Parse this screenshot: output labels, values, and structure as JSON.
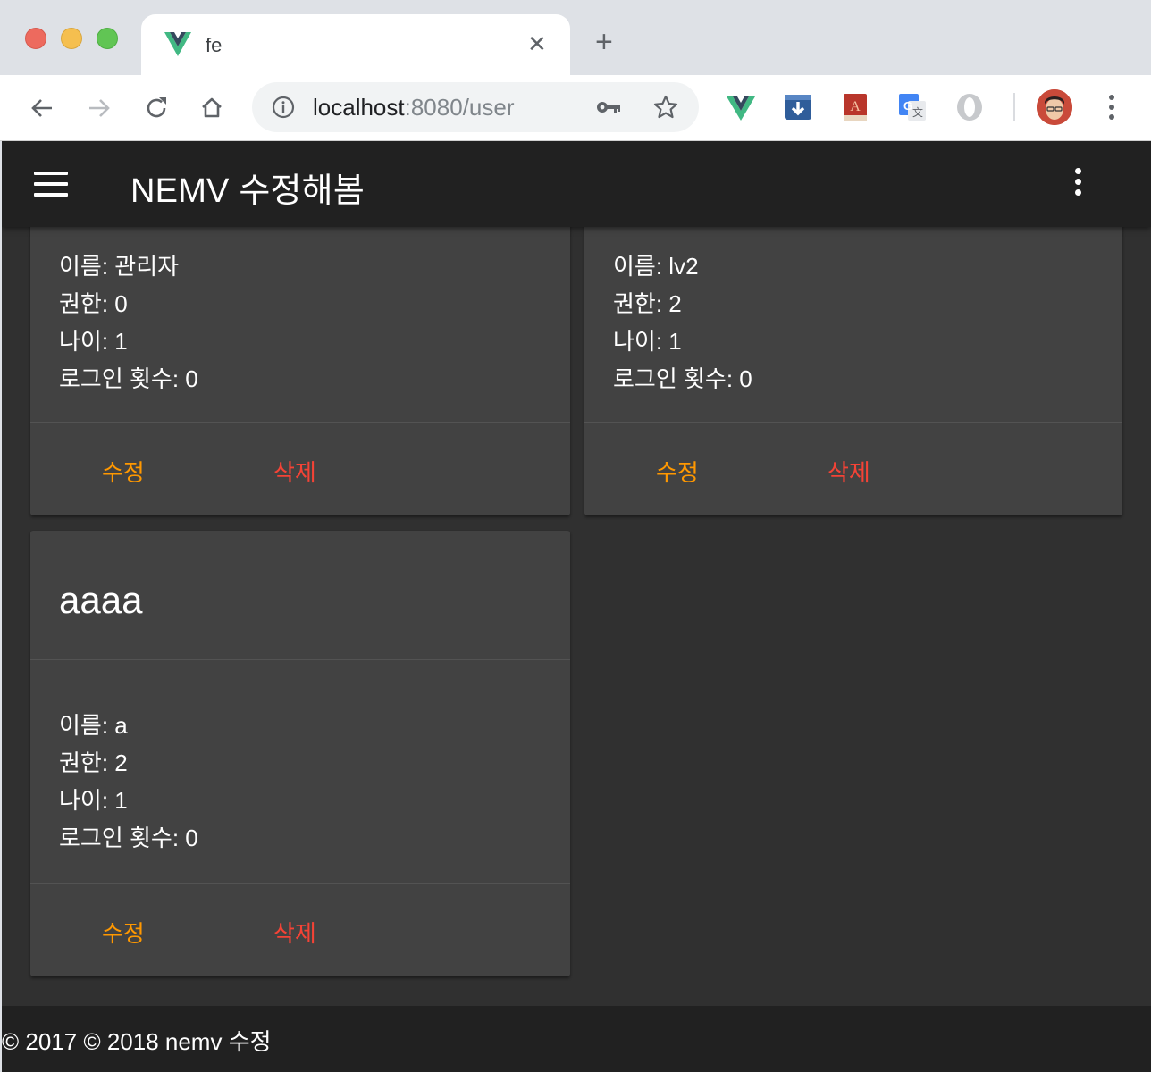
{
  "browser": {
    "tab": {
      "title": "fe",
      "close_glyph": "✕",
      "favicon": "vue-logo-icon"
    },
    "new_tab_glyph": "+",
    "address": {
      "host": "localhost",
      "rest": ":8080/user"
    },
    "extensions": [
      "vue-devtools-icon",
      "download-icon",
      "dictionary-icon",
      "google-translate-icon",
      "opera-icon"
    ]
  },
  "app": {
    "title": "NEMV 수정해봄"
  },
  "cards": [
    {
      "title": "",
      "lines": [
        "이름: 관리자",
        "권한: 0",
        "나이: 1",
        "로그인 횟수: 0"
      ],
      "edit": "수정",
      "delete": "삭제"
    },
    {
      "title": "",
      "lines": [
        "이름: lv2",
        "권한: 2",
        "나이: 1",
        "로그인 횟수: 0"
      ],
      "edit": "수정",
      "delete": "삭제"
    },
    {
      "title": "aaaa",
      "lines": [
        "이름: a",
        "권한: 2",
        "나이: 1",
        "로그인 횟수: 0"
      ],
      "edit": "수정",
      "delete": "삭제"
    }
  ],
  "footer": {
    "text": "© 2017 © 2018 nemv 수정"
  },
  "colors": {
    "appbar": "#212121",
    "page_bg": "#303030",
    "card_bg": "#424242",
    "edit_button": "#ff9800",
    "delete_button": "#f44336"
  }
}
